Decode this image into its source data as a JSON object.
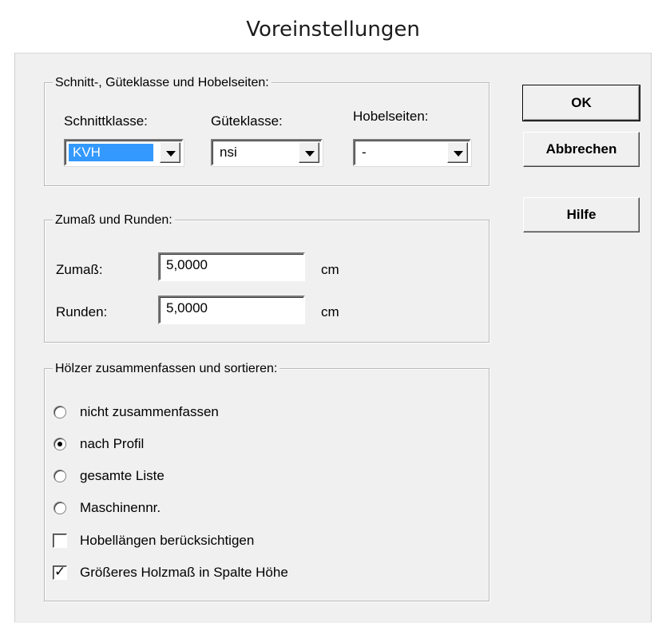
{
  "window": {
    "title": "Voreinstellungen"
  },
  "group_schnitt": {
    "legend": "Schnitt-, Güteklasse und Hobelseiten:",
    "schnittklasse": {
      "label": "Schnittklasse:",
      "value": "KVH"
    },
    "gueteklasse": {
      "label": "Güteklasse:",
      "value": "nsi"
    },
    "hobelseiten": {
      "label": "Hobelseiten:",
      "value": "-"
    }
  },
  "group_zumass": {
    "legend": "Zumaß und Runden:",
    "zumass": {
      "label": "Zumaß:",
      "value": "5,0000",
      "unit": "cm"
    },
    "runden": {
      "label": "Runden:",
      "value": "5,0000",
      "unit": "cm"
    }
  },
  "group_hoelzer": {
    "legend": "Hölzer zusammenfassen und sortieren:",
    "options": [
      {
        "label": "nicht zusammenfassen",
        "checked": false
      },
      {
        "label": "nach Profil",
        "checked": true
      },
      {
        "label": "gesamte Liste",
        "checked": false
      },
      {
        "label": "Maschinennr.",
        "checked": false
      }
    ],
    "checkboxes": [
      {
        "label": "Hobellängen berücksichtigen",
        "checked": false
      },
      {
        "label": "Größeres Holzmaß in Spalte Höhe",
        "checked": true
      }
    ]
  },
  "buttons": {
    "ok": "OK",
    "cancel": "Abbrechen",
    "help": "Hilfe"
  },
  "check_glyph": "✓"
}
